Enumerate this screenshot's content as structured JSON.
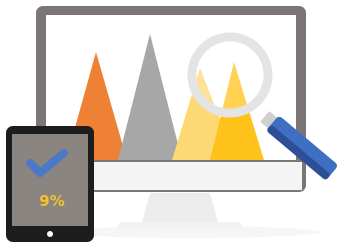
{
  "illustration": {
    "tablet": {
      "percent_label": "9%",
      "icon": "checkmark-icon"
    },
    "monitor": {
      "icon": "triangle-chart"
    },
    "magnifier": {
      "icon": "magnifying-glass-icon"
    }
  },
  "colors": {
    "monitor_frame": "#7b7575",
    "monitor_screen": "#ffffff",
    "monitor_stand": "#ebebeb",
    "monitor_base": "#f0f0f0",
    "monitor_shadow": "#f5f5f5",
    "triangle_orange": "#ee8133",
    "triangle_gray": "#a7a7a7",
    "triangle_light_yellow": "#fdd873",
    "triangle_yellow": "#ffc21b",
    "magnifier_ring": "#e4e4e4",
    "magnifier_handle": "#3f6fc2",
    "magnifier_handle_dark": "#2d4f97",
    "tablet_body": "#1d1d1d",
    "tablet_screen": "#8a8580",
    "tablet_check": "#4b79c8",
    "tablet_text": "#f4c22a"
  }
}
